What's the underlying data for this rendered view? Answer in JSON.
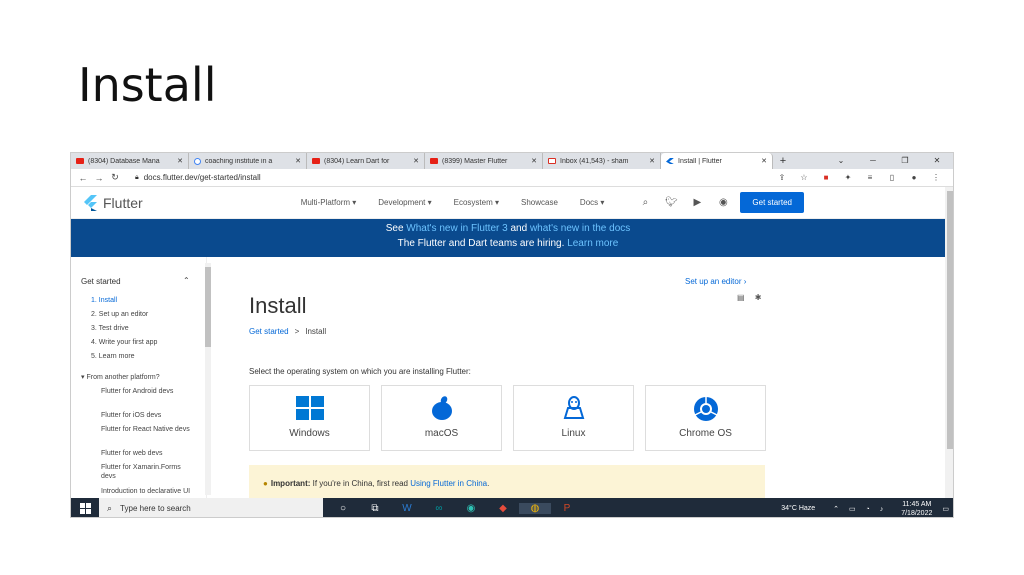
{
  "slide": {
    "title": "Install"
  },
  "browser": {
    "tabs": [
      {
        "title": "(8304) Database Mana",
        "favicon": "youtube-icon",
        "color": "#e62117"
      },
      {
        "title": "coaching institute in a",
        "favicon": "google-icon",
        "color": "#4285f4"
      },
      {
        "title": "(8304) Learn Dart for",
        "favicon": "youtube-icon",
        "color": "#e62117"
      },
      {
        "title": "(8399) Master Flutter",
        "favicon": "youtube-icon",
        "color": "#e62117"
      },
      {
        "title": "Inbox (41,543) - sham",
        "favicon": "gmail-icon",
        "color": "#d93025"
      },
      {
        "title": "Install | Flutter",
        "favicon": "flutter-icon",
        "color": "#0468d7"
      }
    ],
    "new_tab": "+",
    "url": "docs.flutter.dev/get-started/install"
  },
  "site": {
    "logo_text": "Flutter",
    "nav": [
      "Multi-Platform ▾",
      "Development ▾",
      "Ecosystem ▾",
      "Showcase",
      "Docs ▾"
    ],
    "get_started": "Get started",
    "banner": {
      "l1_a": "See ",
      "l1_link1": "What's new in Flutter 3",
      "l1_b": " and ",
      "l1_link2": "what's new in the docs",
      "l2_a": "The Flutter and Dart teams are hiring. ",
      "l2_link": "Learn more"
    }
  },
  "sidebar": {
    "heading": "Get started",
    "items": [
      "1. Install",
      "2. Set up an editor",
      "3. Test drive",
      "4. Write your first app",
      "5. Learn more"
    ],
    "other_heading": "▾ From another platform?",
    "other_items": [
      "Flutter for Android devs",
      "Flutter for iOS devs",
      "Flutter for React Native devs",
      "Flutter for web devs",
      "Flutter for Xamarin.Forms devs",
      "Introduction to declarative UI"
    ]
  },
  "main": {
    "setup_link": "Set up an editor ›",
    "title": "Install",
    "breadcrumb_1": "Get started",
    "breadcrumb_sep": ">",
    "breadcrumb_2": "Install",
    "select_text": "Select the operating system on which you are installing Flutter:",
    "os": [
      "Windows",
      "macOS",
      "Linux",
      "Chrome OS"
    ],
    "notice_bold": "Important:",
    "notice_text": " If you're in China, first read ",
    "notice_link": "Using Flutter in China",
    "notice_end": "."
  },
  "taskbar": {
    "search_placeholder": "Type here to search",
    "weather": "34°C  Haze",
    "time": "11:45 AM",
    "date": "7/18/2022"
  }
}
